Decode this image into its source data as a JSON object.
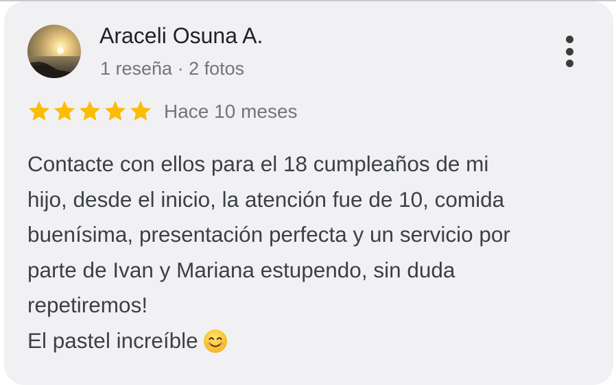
{
  "reviewer": {
    "name": "Araceli Osuna A.",
    "meta": "1 reseña · 2 fotos",
    "avatar_icon": "sunset-photo-avatar"
  },
  "rating": {
    "stars": 5,
    "max_stars": 5,
    "time": "Hace 10 meses",
    "star_color": "#fbbc04"
  },
  "review": {
    "text": "Contacte con ellos para el 18 cumpleaños de mi\nhijo, desde el inicio, la atención fue de 10, comida\nbuenísima, presentación perfecta y un servicio por\nparte de Ivan y Mariana estupendo, sin duda\nrepetiremos!\nEl pastel increíble",
    "emoji": "smiling-face-emoji"
  },
  "actions": {
    "more_icon": "more-vert-icon"
  }
}
